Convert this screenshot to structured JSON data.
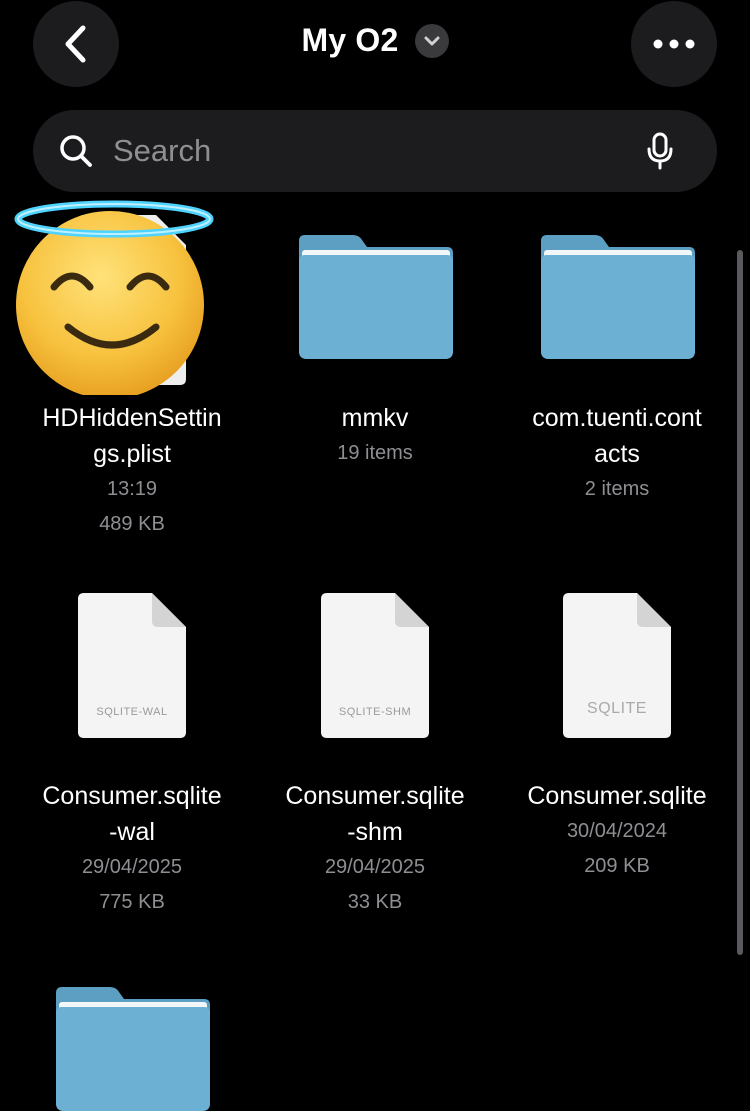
{
  "header": {
    "title": "My O2",
    "back_icon": "chevron-left-icon",
    "more_icon": "ellipsis-icon",
    "title_menu_icon": "chevron-down-icon"
  },
  "search": {
    "placeholder": "Search",
    "value": "",
    "search_icon": "magnifier-icon",
    "mic_icon": "microphone-icon"
  },
  "items": [
    {
      "name_line1": "HDHiddenSettin",
      "name_line2": "gs.plist",
      "meta1": "13:19",
      "meta2": "489 KB",
      "kind": "file",
      "overlay": "smiling-face-with-halo-emoji"
    },
    {
      "name_line1": "mmkv",
      "name_line2": "",
      "meta1": "19 items",
      "meta2": "",
      "kind": "folder"
    },
    {
      "name_line1": "com.tuenti.cont",
      "name_line2": "acts",
      "meta1": "2 items",
      "meta2": "",
      "kind": "folder"
    },
    {
      "name_line1": "Consumer.sqlite",
      "name_line2": "-wal",
      "meta1": "29/04/2025",
      "meta2": "775 KB",
      "kind": "file",
      "label": "SQLITE-WAL"
    },
    {
      "name_line1": "Consumer.sqlite",
      "name_line2": "-shm",
      "meta1": "29/04/2025",
      "meta2": "33 KB",
      "kind": "file",
      "label": "SQLITE-SHM"
    },
    {
      "name_line1": "Consumer.sqlite",
      "name_line2": "",
      "meta1": "30/04/2024",
      "meta2": "209 KB",
      "kind": "file",
      "label": "SQLITE"
    },
    {
      "kind": "folder"
    }
  ],
  "colors": {
    "background": "#000000",
    "control": "#1c1c1e",
    "folder": "#6aaed0",
    "secondary_text": "#8e8e93"
  }
}
